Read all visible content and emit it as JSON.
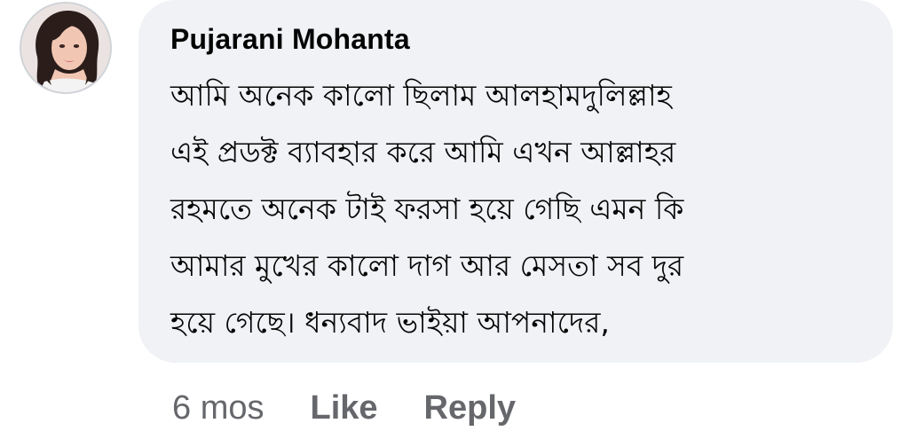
{
  "comment": {
    "author": "Pujarani Mohanta",
    "avatar_icon": "user-profile-photo",
    "text_lines": [
      "আমি অনেক কালো ছিলাম  আলহামদুলিল্লাহ",
      "এই প্রডক্ট ব্যাবহার করে আমি এখন আল্লাহর",
      "রহমতে অনেক টাই ফরসা হয়ে গেছি এমন কি",
      "আমার মুখের কালো দাগ আর মেসতা সব দুর",
      "হয়ে গেছে। ধন্যবাদ ভাইয়া আপনাদের,"
    ],
    "bubble_color": "#f0f2f5"
  },
  "actions": {
    "timestamp": "6 mos",
    "like_label": "Like",
    "reply_label": "Reply",
    "text_color": "#65676b"
  }
}
